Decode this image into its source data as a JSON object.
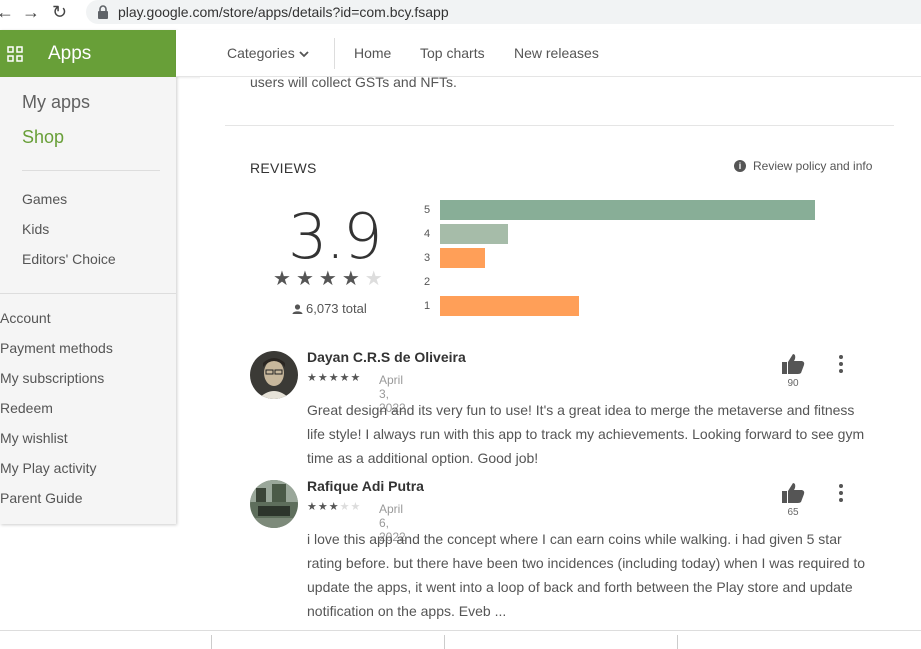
{
  "browser": {
    "url": "play.google.com/store/apps/details?id=com.bcy.fsapp",
    "back_icon": "back-arrow-icon",
    "forward_icon": "forward-arrow-icon",
    "reload_icon": "reload-icon"
  },
  "sidebar": {
    "title": "Apps",
    "my_apps": "My apps",
    "shop": "Shop",
    "categories": [
      "Games",
      "Kids",
      "Editors' Choice"
    ],
    "account_links": [
      "Account",
      "Payment methods",
      "My subscriptions",
      "Redeem",
      "My wishlist",
      "My Play activity",
      "Parent Guide"
    ]
  },
  "topnav": {
    "categories": "Categories",
    "home": "Home",
    "top_charts": "Top charts",
    "new_releases": "New releases"
  },
  "description_tail": "users will collect GSTs and NFTs.",
  "reviews": {
    "title": "REVIEWS",
    "policy": "Review policy and info",
    "score": "3.9",
    "score_stars": 4,
    "total": "6,073 total",
    "distribution": [
      {
        "label": "5",
        "fraction": 1.0,
        "color": "#88ae97"
      },
      {
        "label": "4",
        "fraction": 0.18,
        "color": "#a6bca9"
      },
      {
        "label": "3",
        "fraction": 0.12,
        "color": "#ff9f58"
      },
      {
        "label": "2",
        "fraction": 0.0,
        "color": "#ff9f58"
      },
      {
        "label": "1",
        "fraction": 0.37,
        "color": "#ff9f58"
      }
    ],
    "items": [
      {
        "name": "Dayan C.R.S de Oliveira",
        "stars": 5,
        "date": "April 3, 2022",
        "likes": "90",
        "text": "Great design and its very fun to use! It's a great idea to merge the metaverse and fitness life style! I always run with this app to track my achievements. Looking forward to see gym time as a additional option. Good job!"
      },
      {
        "name": "Rafique Adi Putra",
        "stars": 3,
        "date": "April 6, 2022",
        "likes": "65",
        "text": "i love this app and the concept where I can earn coins while walking. i had given 5 star rating before. but there have been two incidences (including today) when I was required to update the apps, it went into a loop of back and forth between the Play store and update notification on the apps. Eveb ..."
      }
    ]
  }
}
